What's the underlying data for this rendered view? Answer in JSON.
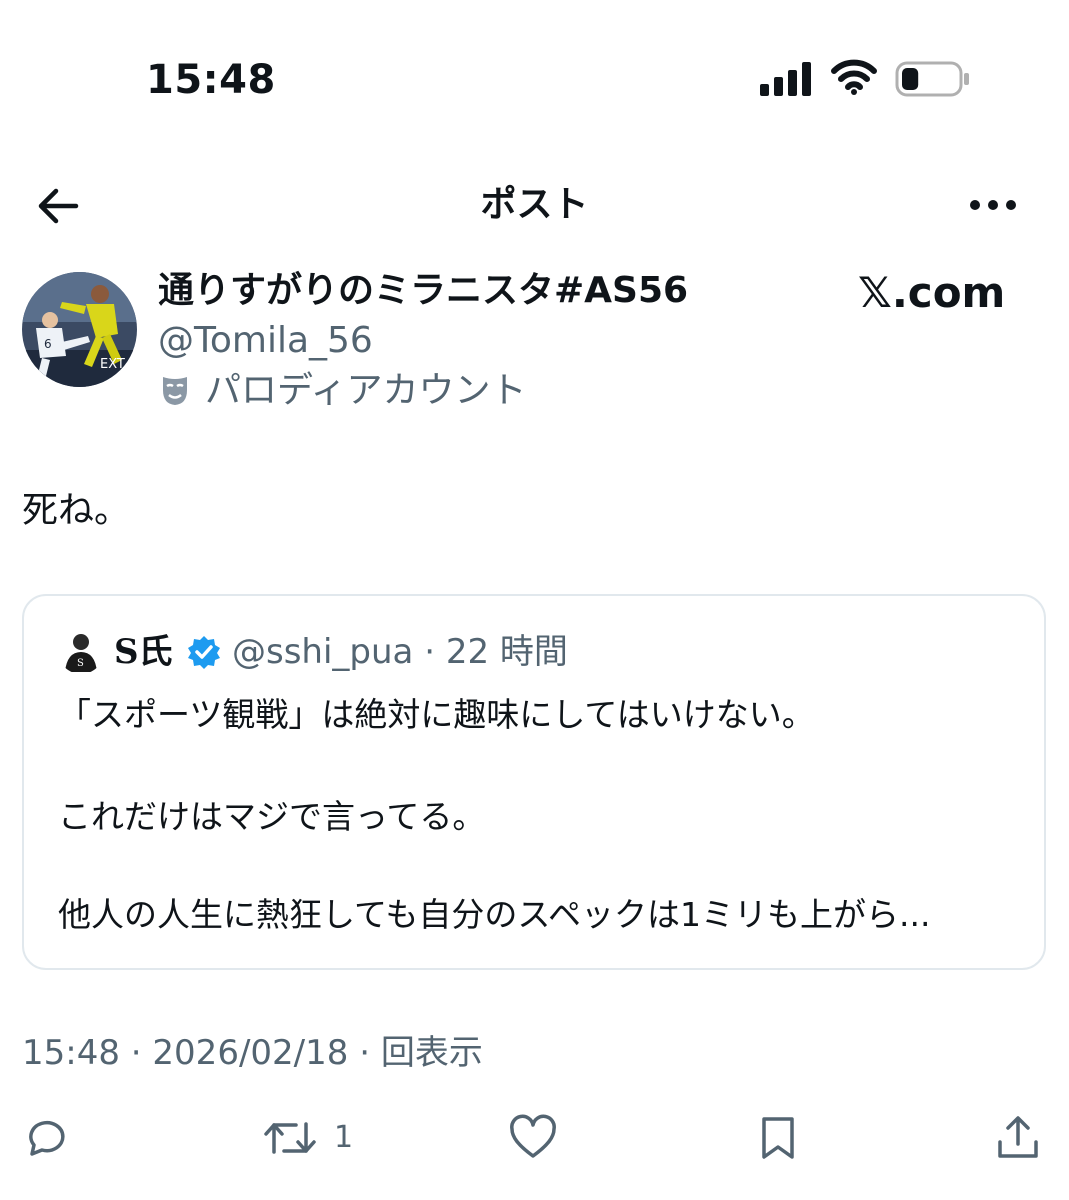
{
  "status_bar": {
    "time": "15:48",
    "battery_level": 0.3
  },
  "nav": {
    "title": "ポスト",
    "back_icon": "arrow-left-icon",
    "more_icon": "more-horizontal-icon"
  },
  "author": {
    "display_name": "通りすがりのミラニスタ#AS56",
    "handle": "@Tomila_56",
    "parody_label": "パロディアカウント"
  },
  "watermark": "𝕏.com",
  "post": {
    "text": "死ね。"
  },
  "quoted": {
    "name": "S氏",
    "verified": true,
    "handle": "@sshi_pua",
    "age": "22 時間",
    "lines": [
      "「スポーツ観戦」は絶対に趣味にしてはいけない。",
      "これだけはマジで言ってる。",
      "他人の人生に熱狂しても自分のスペックは1ミリも上がら..."
    ]
  },
  "meta": {
    "time": "15:48",
    "date": "2026/02/18",
    "views": "回表示"
  },
  "actions": {
    "retweet_count": "1"
  },
  "colors": {
    "text": "#0f1419",
    "secondary": "#536471",
    "verified": "#1d9bf0",
    "border": "#e1e8ed"
  }
}
